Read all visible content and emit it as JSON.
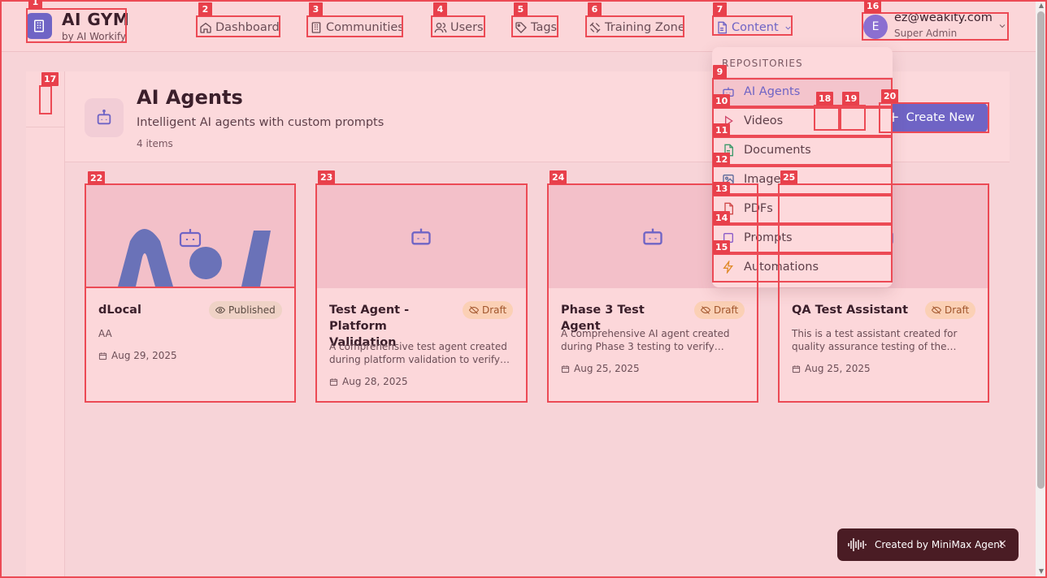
{
  "header": {
    "brand_title": "AI GYM",
    "brand_sub": "by AI Workify",
    "nav": [
      {
        "label": "Dashboard",
        "icon": "home-icon"
      },
      {
        "label": "Communities",
        "icon": "building-icon"
      },
      {
        "label": "Users",
        "icon": "users-icon"
      },
      {
        "label": "Tags",
        "icon": "tag-icon"
      },
      {
        "label": "Training Zone",
        "icon": "dumbbell-icon"
      },
      {
        "label": "Content",
        "icon": "file-icon"
      }
    ],
    "user": {
      "initial": "E",
      "email": "ez@weakity.com",
      "role": "Super Admin"
    }
  },
  "page": {
    "title": "AI Agents",
    "description": "Intelligent AI agents with custom prompts",
    "count": "4 items",
    "create_label": "Create New"
  },
  "dropdown": {
    "heading": "REPOSITORIES",
    "items": [
      {
        "label": "AI Agents",
        "icon": "bot-icon",
        "active": true
      },
      {
        "label": "Videos",
        "icon": "play-icon"
      },
      {
        "label": "Documents",
        "icon": "document-icon"
      },
      {
        "label": "Images",
        "icon": "image-icon"
      },
      {
        "label": "PDFs",
        "icon": "pdf-icon"
      },
      {
        "label": "Prompts",
        "icon": "prompt-icon"
      },
      {
        "label": "Automations",
        "icon": "lightning-icon"
      }
    ]
  },
  "cards": [
    {
      "title": "dLocal",
      "status": "Published",
      "description": "AA",
      "date": "Aug 29, 2025"
    },
    {
      "title": "Test Agent - Platform Validation",
      "status": "Draft",
      "description": "A comprehensive test agent created during platform validation to verify…",
      "date": "Aug 28, 2025"
    },
    {
      "title": "Phase 3 Test Agent",
      "status": "Draft",
      "description": "A comprehensive AI agent created during Phase 3 testing to verify…",
      "date": "Aug 25, 2025"
    },
    {
      "title": "QA Test Assistant",
      "status": "Draft",
      "description": "This is a test assistant created for quality assurance testing of the…",
      "date": "Aug 25, 2025"
    }
  ],
  "toast": {
    "text": "Created by MiniMax Agent",
    "close": "×"
  },
  "markers": [
    "1",
    "2",
    "3",
    "4",
    "5",
    "6",
    "7",
    "9",
    "10",
    "11",
    "12",
    "13",
    "14",
    "15",
    "16",
    "17",
    "18",
    "19",
    "20",
    "22",
    "23",
    "24",
    "25"
  ],
  "colors": {
    "accent": "#6f64c5",
    "marker": "#e8404b",
    "background": "#f7d4d8"
  }
}
